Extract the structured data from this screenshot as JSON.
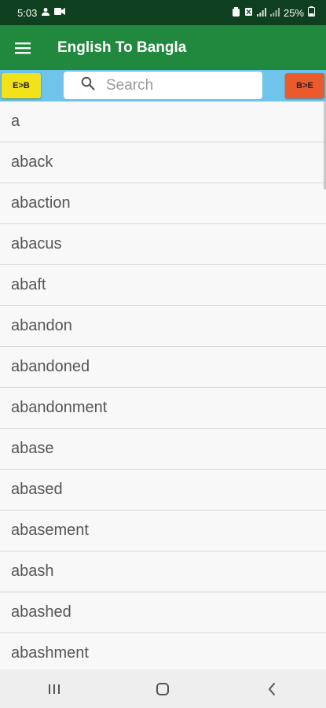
{
  "status_bar": {
    "time": "5:03",
    "battery": "25%"
  },
  "app_bar": {
    "title": "English To Bangla",
    "menu_icon": "hamburger-menu-icon"
  },
  "search_bar": {
    "left_button": "E>B",
    "right_button": "B>E",
    "placeholder": "Search",
    "value": "",
    "search_icon": "search-icon"
  },
  "word_list": [
    "a",
    "aback",
    "abaction",
    "abacus",
    "abaft",
    "abandon",
    "abandoned",
    "abandonment",
    "abase",
    "abased",
    "abasement",
    "abash",
    "abashed",
    "abashment"
  ],
  "nav_bar": {
    "recent_icon": "recent-apps-icon",
    "home_icon": "home-icon",
    "back_icon": "back-icon"
  },
  "colors": {
    "status_bar": "#0e3f1f",
    "app_bar": "#21893d",
    "search_strip": "#6ec4ea",
    "eb_button": "#f2e21a",
    "be_button": "#ea5a2c"
  }
}
